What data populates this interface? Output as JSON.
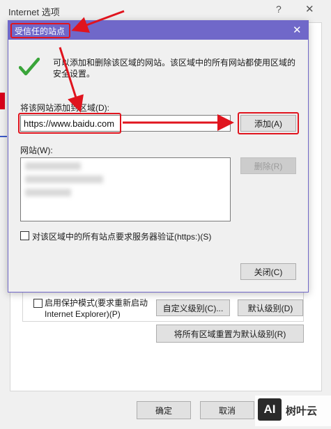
{
  "outer_window": {
    "title": "Internet 选项",
    "help_glyph": "?",
    "close_glyph": "✕",
    "protected_mode_label": "启用保护模式(要求重新启动 Internet Explorer)(P)",
    "custom_level_button": "自定义级别(C)...",
    "default_level_button": "默认级别(D)",
    "reset_all_button": "将所有区域重置为默认级别(R)",
    "ok_button": "确定",
    "cancel_button": "取消"
  },
  "dialog": {
    "title": "受信任的站点",
    "close_glyph": "✕",
    "info_text": "可以添加和删除该区域的网站。该区域中的所有网站都使用区域的安全设置。",
    "add_label": "将该网站添加到区域(D):",
    "url_value": "https://www.baidu.com",
    "add_button": "添加(A)",
    "websites_label": "网站(W):",
    "remove_button": "删除(R)",
    "https_verify_label": "对该区域中的所有站点要求服务器验证(https:)(S)",
    "close_button": "关闭(C)"
  },
  "watermark": {
    "logo": "AI",
    "text": "树叶云"
  },
  "colors": {
    "dialog_title_bar": "#7068c9",
    "highlight_red": "#e0141e",
    "check_green": "#3aa53a"
  }
}
